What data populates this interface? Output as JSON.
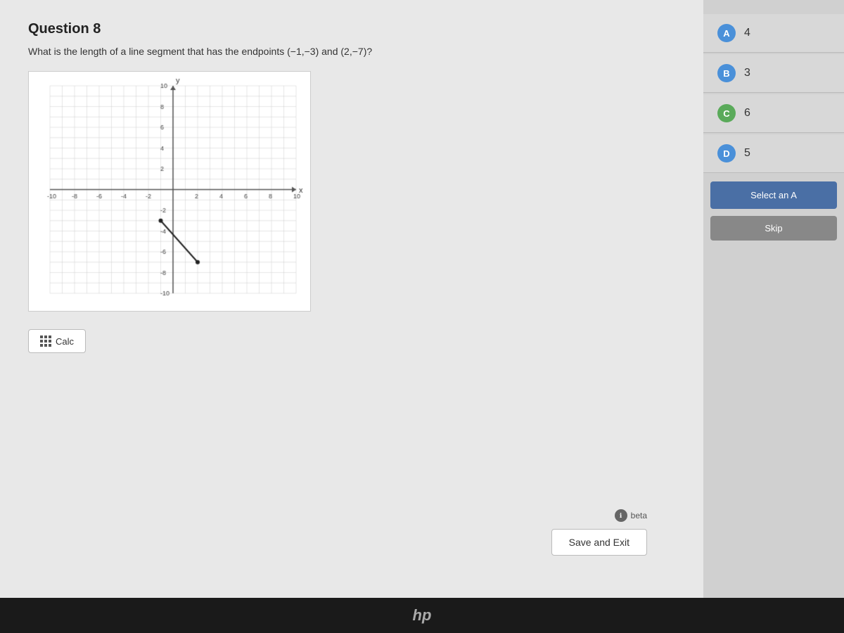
{
  "question": {
    "number": "Question 8",
    "text": "What is the length of a line segment that has the endpoints (−1,−3) and (2,−7)?",
    "graph": {
      "xMin": -10,
      "xMax": 10,
      "yMin": -10,
      "yMax": 10,
      "point1": [
        -1,
        -3
      ],
      "point2": [
        2,
        -7
      ]
    }
  },
  "answers": [
    {
      "id": "a",
      "label": "A",
      "value": "4",
      "badge_class": "badge-a"
    },
    {
      "id": "b",
      "label": "B",
      "value": "3",
      "badge_class": "badge-b"
    },
    {
      "id": "c",
      "label": "C",
      "value": "6",
      "badge_class": "badge-c"
    },
    {
      "id": "d",
      "label": "D",
      "value": "5",
      "badge_class": "badge-d"
    }
  ],
  "buttons": {
    "calc": "Calc",
    "save_exit": "Save and Exit",
    "select_answer": "Select an A",
    "skip": "Skip"
  },
  "beta": "beta",
  "hp_logo": "hp"
}
